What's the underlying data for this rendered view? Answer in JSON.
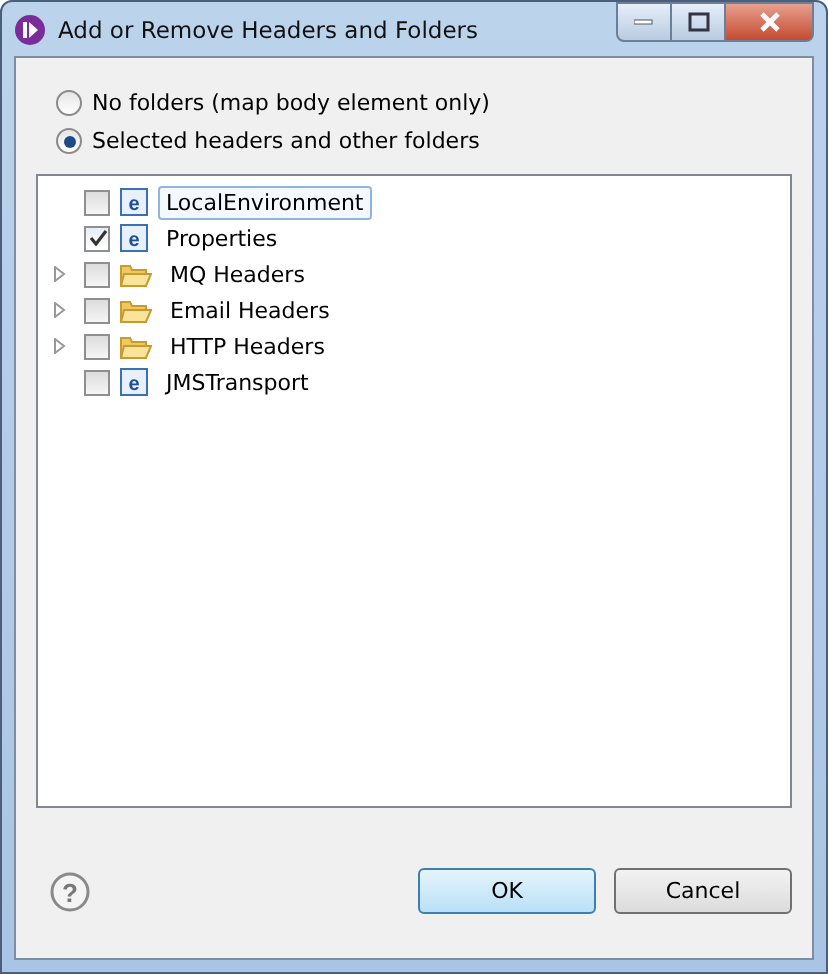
{
  "window": {
    "title": "Add or Remove Headers and Folders"
  },
  "options": [
    {
      "label": "No folders (map body element only)",
      "selected": false
    },
    {
      "label": "Selected headers and other folders",
      "selected": true
    }
  ],
  "tree": [
    {
      "label": "LocalEnvironment",
      "kind": "element",
      "icon": "e",
      "checked": false,
      "selected": true,
      "expandable": false
    },
    {
      "label": "Properties",
      "kind": "element",
      "icon": "e",
      "checked": true,
      "selected": false,
      "expandable": false
    },
    {
      "label": "MQ Headers",
      "kind": "folder",
      "checked": false,
      "selected": false,
      "expandable": true
    },
    {
      "label": "Email Headers",
      "kind": "folder",
      "checked": false,
      "selected": false,
      "expandable": true
    },
    {
      "label": "HTTP Headers",
      "kind": "folder",
      "checked": false,
      "selected": false,
      "expandable": true
    },
    {
      "label": "JMSTransport",
      "kind": "element",
      "icon": "e",
      "checked": false,
      "selected": false,
      "expandable": false
    }
  ],
  "help": "?",
  "buttons": [
    {
      "label": "OK",
      "default": true
    },
    {
      "label": "Cancel",
      "default": false
    }
  ]
}
